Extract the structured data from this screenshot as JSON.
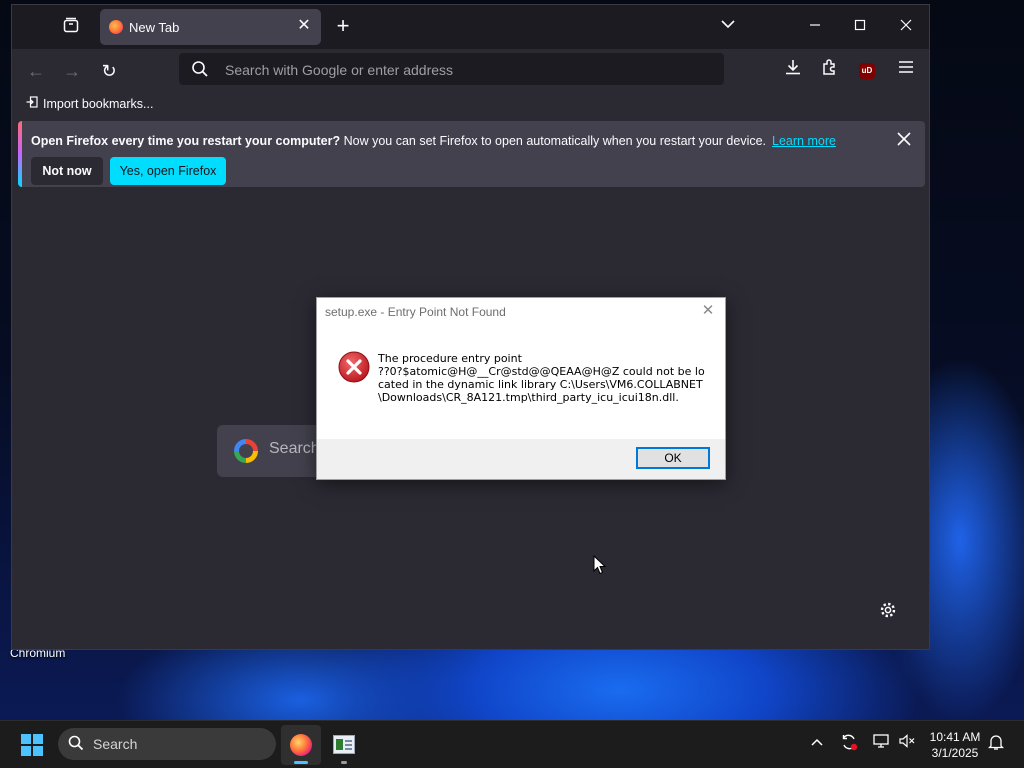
{
  "desktop": {
    "label_chromium": "Chromium"
  },
  "browser": {
    "tab": {
      "title": "New Tab"
    },
    "urlbar": {
      "placeholder": "Search with Google or enter address"
    },
    "bookmarks": {
      "import_label": "Import bookmarks..."
    },
    "infobar": {
      "bold_text": "Open Firefox every time you restart your computer?",
      "text": " Now you can set Firefox to open automatically when you restart your device.",
      "link": "Learn more",
      "not_now_label": "Not now",
      "yes_label": "Yes, open Firefox"
    },
    "newtab": {
      "search_placeholder": "Search"
    }
  },
  "dialog": {
    "title": "setup.exe - Entry Point Not Found",
    "message": "The procedure entry point\n??0?$atomic@H@__Cr@std@@QEAA@H@Z could not be located in the dynamic link library C:\\Users\\VM6.COLLABNET\\Downloads\\CR_8A121.tmp\\third_party_icu_icui18n.dll.",
    "ok_label": "OK"
  },
  "taskbar": {
    "search_label": "Search",
    "time": "10:41 AM",
    "date": "3/1/2025"
  },
  "colors": {
    "infobar_accent": "#00ddff",
    "windows_accent": "#4cc2ff",
    "error_red": "#d8262b"
  }
}
